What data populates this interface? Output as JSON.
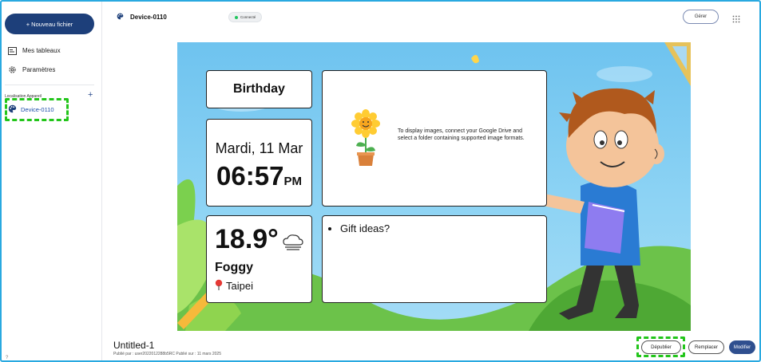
{
  "sidebar": {
    "new_file_label": "+ Nouveau fichier",
    "items": [
      {
        "label": "Mes tableaux",
        "icon": "board-icon"
      },
      {
        "label": "Paramètres",
        "icon": "gear-icon"
      }
    ],
    "location_label": "Localisation Appareil",
    "devices": [
      {
        "label": "Device-0110",
        "icon": "palette-icon"
      }
    ],
    "highlight_color": "#22c51a"
  },
  "topbar": {
    "device_name": "Device-0110",
    "status": "Connecté",
    "status_color": "#22c55e",
    "manage_label": "Gérer"
  },
  "board": {
    "birthday_title": "Birthday",
    "date": "Mardi, 11 Mar",
    "time": "06:57",
    "ampm": "PM",
    "photo_message": "To display images, connect your Google Drive and select a folder containing supported image formats.",
    "temperature": "18.9°",
    "condition": "Foggy",
    "city": "Taipei",
    "notes": [
      "Gift ideas?"
    ]
  },
  "footer": {
    "title": "Untitled-1",
    "subtitle": "Publié par : user2022012288b5RC Publié sur : 11 mars 2025",
    "unpublish_label": "Dépublier",
    "replace_label": "Remplacer",
    "edit_label": "Modifier",
    "help": "?"
  },
  "colors": {
    "primary": "#1d3f7a",
    "accent_border": "#29a9e0"
  }
}
